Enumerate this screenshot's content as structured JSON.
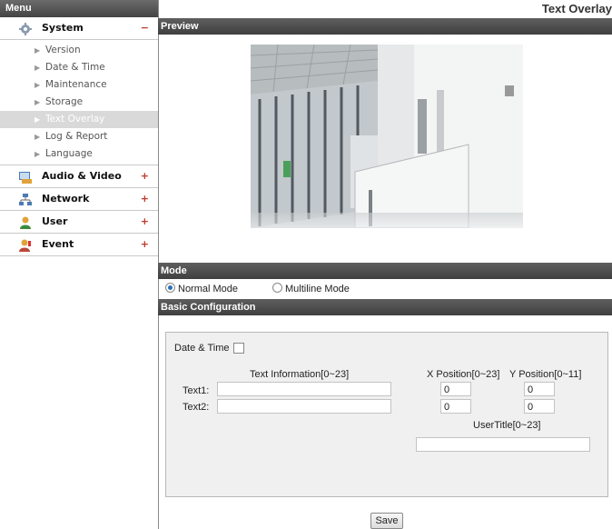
{
  "menu": {
    "header": "Menu",
    "system": {
      "label": "System",
      "toggle": "−"
    },
    "system_items": [
      "Version",
      "Date & Time",
      "Maintenance",
      "Storage",
      "Text Overlay",
      "Log & Report",
      "Language"
    ],
    "audio_video": {
      "label": "Audio & Video",
      "toggle": "+"
    },
    "network": {
      "label": "Network",
      "toggle": "+"
    },
    "user": {
      "label": "User",
      "toggle": "+"
    },
    "event": {
      "label": "Event",
      "toggle": "+"
    }
  },
  "page": {
    "title": "Text Overlay"
  },
  "preview": {
    "heading": "Preview"
  },
  "mode": {
    "heading": "Mode",
    "normal_label": "Normal Mode",
    "multiline_label": "Multiline Mode",
    "selected": "Normal Mode"
  },
  "basic": {
    "heading": "Basic Configuration",
    "date_time_label": "Date & Time",
    "date_time_checked": false,
    "text_info_header": "Text Information[0~23]",
    "x_header": "X Position[0~23]",
    "y_header": "Y Position[0~11]",
    "text1_label": "Text1:",
    "text2_label": "Text2:",
    "text1_value": "",
    "text2_value": "",
    "text1_x": "0",
    "text1_y": "0",
    "text2_x": "0",
    "text2_y": "0",
    "usertitle_label": "UserTitle[0~23]",
    "usertitle_value": ""
  },
  "save_label": "Save",
  "colors": {
    "band": "#4a4a4a",
    "active_item": "#d9d9d9",
    "toggle_minus": "#c0392b",
    "toggle_plus": "#c0392b"
  }
}
